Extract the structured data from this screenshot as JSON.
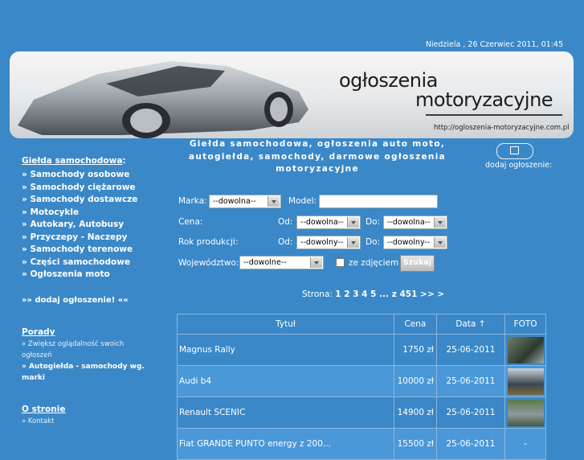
{
  "header": {
    "date": "Niedziela , 26 Czerwiec 2011, 01:45",
    "logo_line1": "ogłoszenia",
    "logo_line2": "motoryzacyjne",
    "url": "http://ogloszenia-motoryzacyjne.com.pl"
  },
  "tagline": "Giełda samochodowa, ogłoszenia auto moto, autogiełda, samochody, darmowe ogłoszenia motoryzacyjne",
  "add_listing_label": "dodaj ogłoszenie:",
  "sidebar": {
    "section1_title": "Giełda samochodowa",
    "section1_colon": ":",
    "items": [
      "» Samochody osobowe",
      "» Samochody ciężarowe",
      "» Samochody dostawcze",
      "» Motocykle",
      "» Autokary, Autobusy",
      "» Przyczepy - Naczepy",
      "» Samochody terenowe",
      "» Części samochodowe",
      "» Ogłoszenia moto"
    ],
    "add_link": "»» dodaj ogłoszenie! ««",
    "section2_title": "Porady",
    "porady_items": [
      "» Zwiększ oglądalność swoich ogłoszeń",
      "» Autogiełda - samochody wg. marki"
    ],
    "section3_title": "O stronie",
    "about_items": [
      "» Kontakt"
    ]
  },
  "form": {
    "marka_label": "Marka:",
    "marka_value": "--dowolna--",
    "model_label": "Model:",
    "model_value": "",
    "cena_label": "Cena:",
    "od_label": "Od:",
    "do_label": "Do:",
    "cena_od": "--dowolna--",
    "cena_do": "--dowolna--",
    "rok_label": "Rok produkcji:",
    "rok_od": "--dowolny--",
    "rok_do": "--dowolny--",
    "woj_label": "Województwo:",
    "woj_value": "--dowolne--",
    "photo_label": "ze zdjęciem",
    "search_button": "Szukaj"
  },
  "pager": {
    "prefix": "Strona:",
    "pages": "1 2 3 4 5 ... z 451 >> >"
  },
  "table": {
    "headers": [
      "Tytuł",
      "Cena",
      "Data ↑",
      "FOTO"
    ],
    "rows": [
      {
        "title": "Magnus Rally",
        "price": "1750 zł",
        "date": "25-06-2011",
        "foto": ""
      },
      {
        "title": "Audi b4",
        "price": "10000 zł",
        "date": "25-06-2011",
        "foto": ""
      },
      {
        "title": "Renault SCENIC",
        "price": "14900 zł",
        "date": "25-06-2011",
        "foto": ""
      },
      {
        "title": "Fiat GRANDE PUNTO energy z 200...",
        "price": "15500 zł",
        "date": "25-06-2011",
        "foto": "-"
      }
    ]
  },
  "colors": {
    "background": "#3a88c8",
    "row_alt": "#4b98d8"
  }
}
